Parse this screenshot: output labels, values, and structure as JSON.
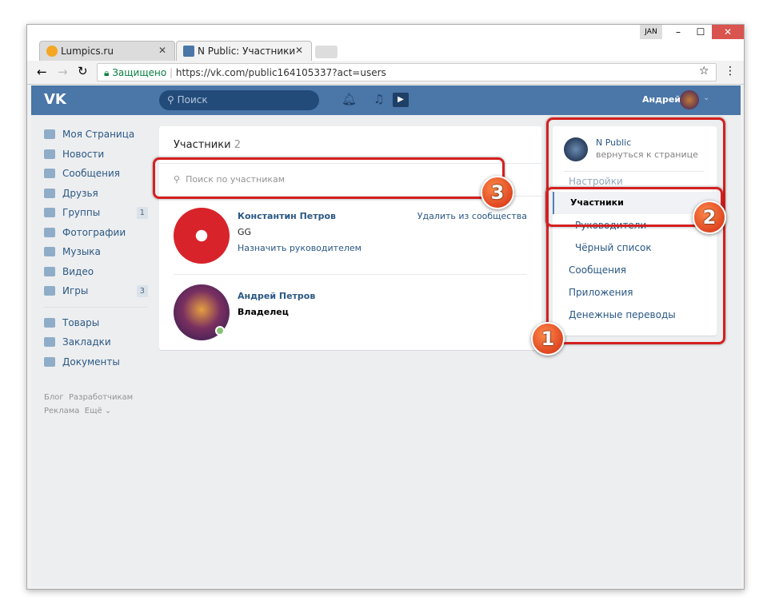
{
  "browser": {
    "tabs": [
      {
        "title": "Lumpics.ru"
      },
      {
        "title": "N Public: Участники"
      }
    ],
    "secure_label": "Защищено",
    "url": "https://vk.com/public164105337?act=users",
    "user_badge": "JAN"
  },
  "header": {
    "logo": "VK",
    "search_placeholder": "Поиск",
    "user_name": "Андрей"
  },
  "sidebar": {
    "items": [
      {
        "label": "Моя Страница"
      },
      {
        "label": "Новости"
      },
      {
        "label": "Сообщения"
      },
      {
        "label": "Друзья"
      },
      {
        "label": "Группы",
        "badge": "1"
      },
      {
        "label": "Фотографии"
      },
      {
        "label": "Музыка"
      },
      {
        "label": "Видео"
      },
      {
        "label": "Игры",
        "badge": "3"
      }
    ],
    "items2": [
      {
        "label": "Товары"
      },
      {
        "label": "Закладки"
      },
      {
        "label": "Документы"
      }
    ],
    "footer": [
      "Блог",
      "Разработчикам",
      "Реклама",
      "Ещё ⌄"
    ]
  },
  "main": {
    "title": "Участники",
    "count": "2",
    "search_placeholder": "Поиск по участникам",
    "members": [
      {
        "name": "Константин Петров",
        "sub": "GG",
        "action": "Назначить руководителем",
        "remove": "Удалить из сообщества"
      },
      {
        "name": "Андрей Петров",
        "role": "Владелец"
      }
    ]
  },
  "menu": {
    "group_name": "N Public",
    "back": "вернуться к странице",
    "items": [
      "Настройки",
      "Участники",
      "Руководители",
      "Чёрный список",
      "Сообщения",
      "Приложения",
      "Денежные переводы"
    ]
  },
  "annotations": [
    "1",
    "2",
    "3"
  ]
}
